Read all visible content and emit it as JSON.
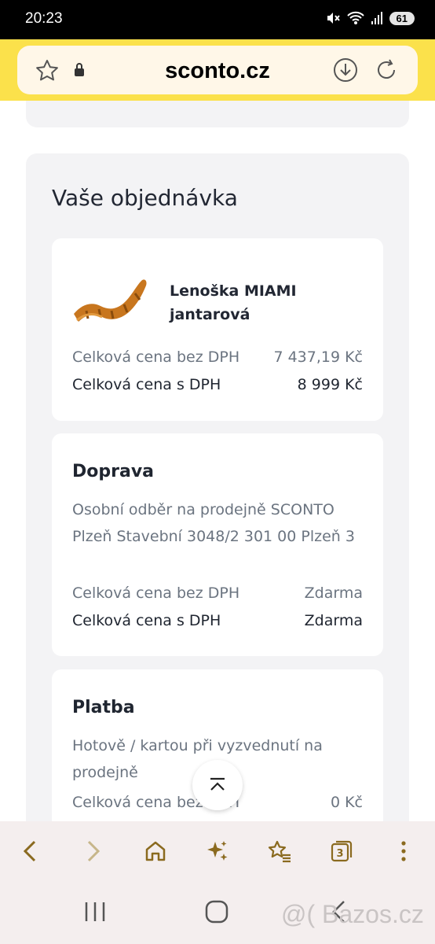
{
  "status_bar": {
    "time": "20:23",
    "battery": "61"
  },
  "browser": {
    "url": "sconto.cz",
    "open_tabs": "3"
  },
  "order": {
    "title": "Vaše objednávka",
    "product": {
      "name": "Lenoška MIAMI jantarová",
      "price_without_vat_label": "Celková cena bez DPH",
      "price_without_vat": "7 437,19 Kč",
      "price_with_vat_label": "Celková cena s DPH",
      "price_with_vat": "8 999 Kč"
    },
    "shipping": {
      "title": "Doprava",
      "description": "Osobní odběr na prodejně SCONTO Plzeň Stavební 3048/2 301 00 Plzeň 3",
      "price_without_vat_label": "Celková cena bez DPH",
      "price_without_vat": "Zdarma",
      "price_with_vat_label": "Celková cena s DPH",
      "price_with_vat": "Zdarma"
    },
    "payment": {
      "title": "Platba",
      "description": "Hotově / kartou při vyzvednutí na prodejně",
      "price_without_vat_label": "Celková cena bez DPH",
      "price_without_vat": "0 Kč"
    }
  },
  "watermark": "@( Bazos.cz",
  "colors": {
    "accent_yellow": "#fbe14b",
    "icon_gold": "#8a6a1f",
    "text_dark": "#1f2530",
    "text_muted": "#6b7480"
  },
  "icons": [
    "star-icon",
    "lock-icon",
    "download-icon",
    "reload-icon",
    "back-icon",
    "forward-icon",
    "home-icon",
    "sparkle-icon",
    "bookmarks-icon",
    "tabs-icon",
    "menu-icon",
    "scroll-top-icon"
  ]
}
